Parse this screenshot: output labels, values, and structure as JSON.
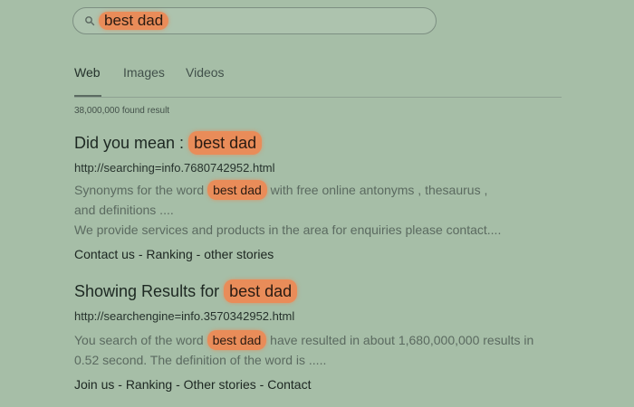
{
  "search": {
    "query": "best dad",
    "icon": "search-icon"
  },
  "tabs": [
    "Web",
    "Images",
    "Videos"
  ],
  "results_count": "38,000,000 found result",
  "results": [
    {
      "title_prefix": "Did you mean : ",
      "title_highlight": "best dad",
      "url": "http://searching=info.7680742952.html",
      "desc1_before": "Synonyms for the word ",
      "desc1_highlight": "best dad",
      "desc1_after": " with free online antonyms , thesaurus ,",
      "desc2": "and definitions ....",
      "desc3": "We provide services and products in the area for enquiries please contact....",
      "links": [
        "Contact us",
        "Ranking",
        "other stories"
      ],
      "separator": " - "
    },
    {
      "title_prefix": "Showing Results for ",
      "title_highlight": "best dad",
      "url": "http://searchengine=info.3570342952.html",
      "desc1_before": "You search of the word ",
      "desc1_highlight": "best dad",
      "desc1_after": " have resulted in about 1,680,000,000 results in",
      "desc2": "0.52 second. The definition of the word is .....",
      "links": [
        "Join us",
        "Ranking",
        "Other stories",
        "Contact"
      ],
      "separator": " - "
    }
  ],
  "colors": {
    "background": "#a6bea7",
    "highlight": "#e98c59",
    "text": "#1f2a24",
    "muted_text": "#5b6a60"
  }
}
